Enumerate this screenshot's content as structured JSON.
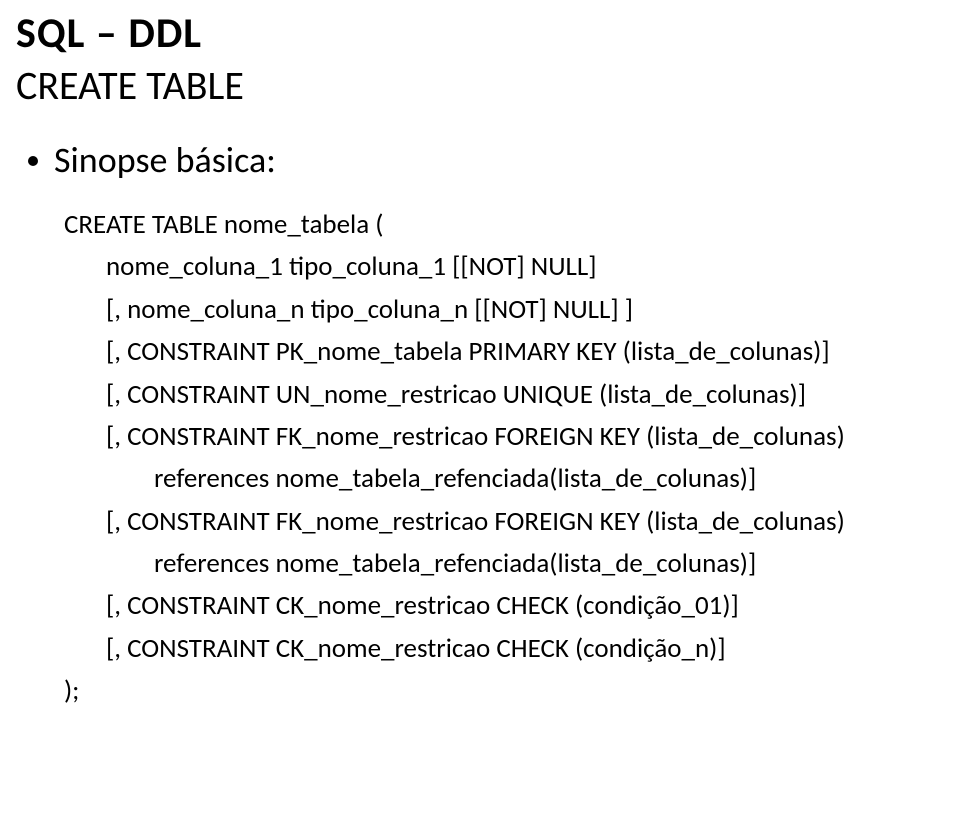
{
  "title_part1": "SQL ",
  "title_dash": "– ",
  "title_part2": "DDL",
  "subtitle": "CREATE TABLE",
  "bullet_label": "Sinopse básica:",
  "code": {
    "l0": "CREATE TABLE nome_tabela (",
    "l1": "nome_coluna_1 tipo_coluna_1 [[NOT] NULL]",
    "l2": "[, nome_coluna_n tipo_coluna_n [[NOT] NULL] ]",
    "l3": "[, CONSTRAINT PK_nome_tabela PRIMARY KEY (lista_de_colunas)]",
    "l4": "[, CONSTRAINT UN_nome_restricao UNIQUE (lista_de_colunas)]",
    "l5": "[, CONSTRAINT FK_nome_restricao FOREIGN KEY (lista_de_colunas)",
    "l6": "references nome_tabela_refenciada(lista_de_colunas)]",
    "l7": "[, CONSTRAINT FK_nome_restricao FOREIGN KEY (lista_de_colunas)",
    "l8": "references nome_tabela_refenciada(lista_de_colunas)]",
    "l9": "[, CONSTRAINT CK_nome_restricao CHECK (condição_01)]",
    "l10": "[, CONSTRAINT CK_nome_restricao CHECK (condição_n)]",
    "l11": ");"
  }
}
